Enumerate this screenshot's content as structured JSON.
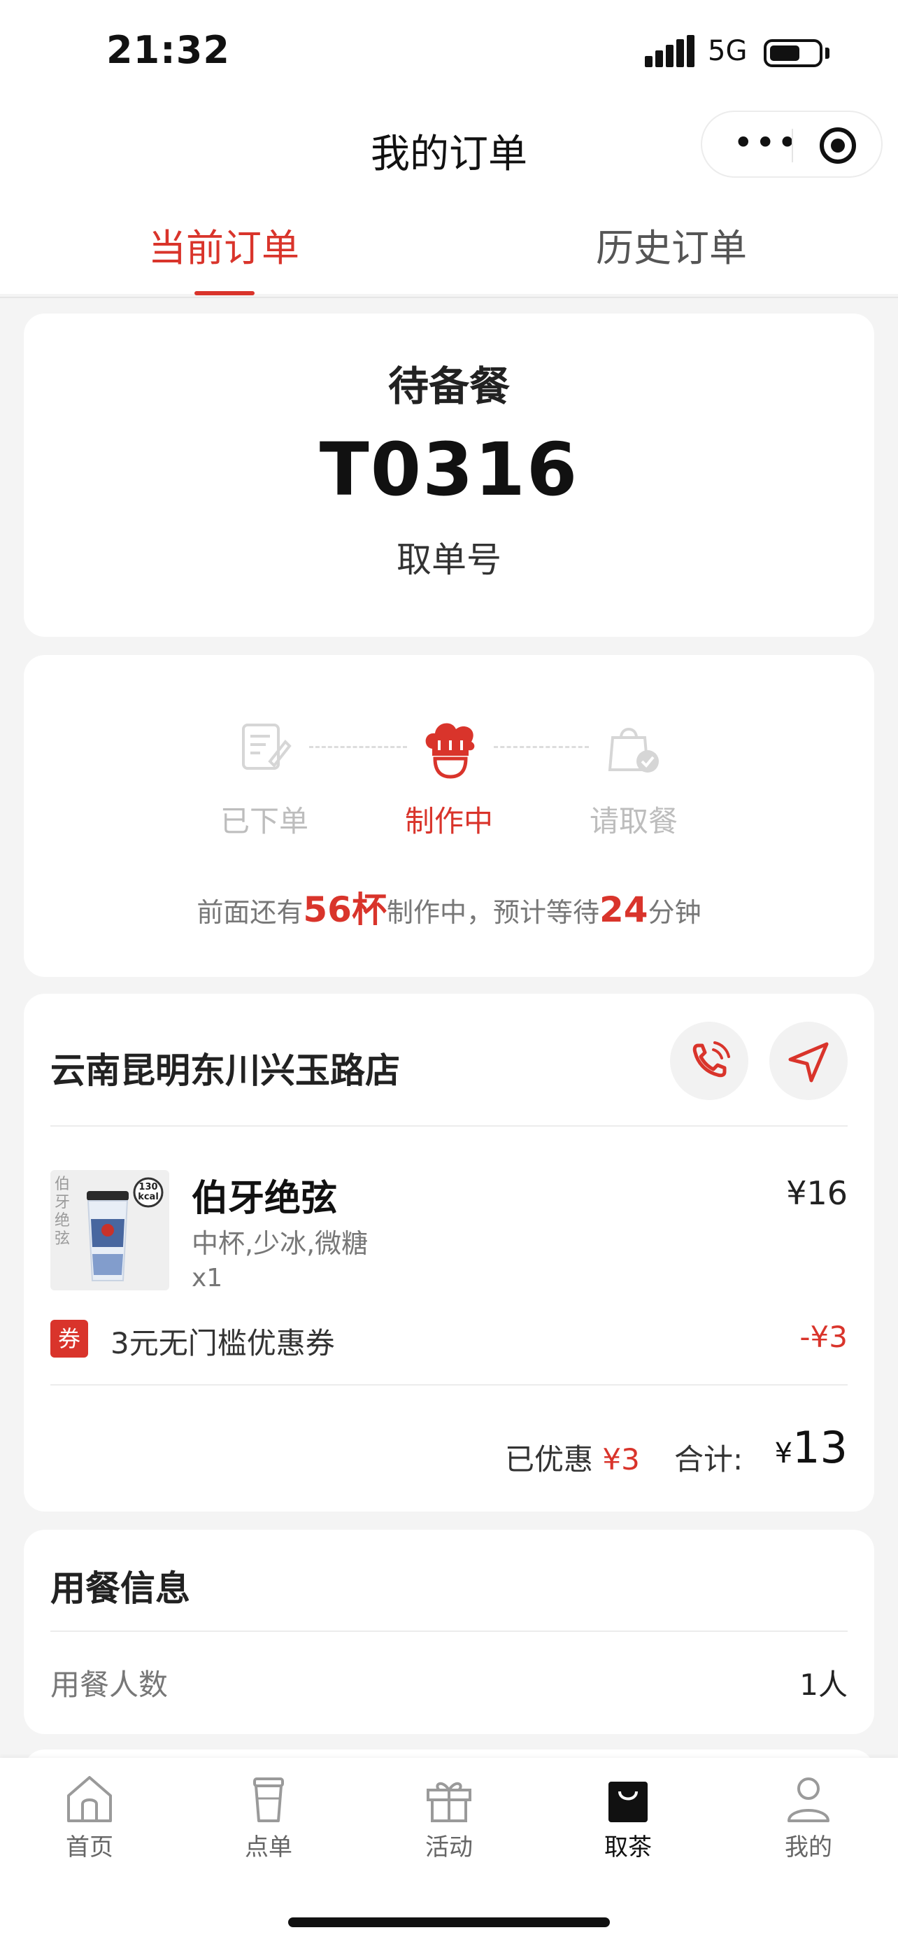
{
  "status_bar": {
    "time": "21:32",
    "network": "5G"
  },
  "header": {
    "title": "我的订单",
    "more_label": "•••"
  },
  "tabs": [
    {
      "label": "当前订单",
      "active": true
    },
    {
      "label": "历史订单",
      "active": false
    }
  ],
  "order": {
    "status": "待备餐",
    "pickup_number": "T0316",
    "pickup_label": "取单号"
  },
  "progress": {
    "steps": [
      {
        "label": "已下单",
        "state": "done"
      },
      {
        "label": "制作中",
        "state": "active"
      },
      {
        "label": "请取餐",
        "state": "pending"
      }
    ],
    "wait_prefix": "前面还有",
    "cups_ahead": "56杯",
    "wait_mid": "制作中，预计等待",
    "wait_minutes": "24",
    "wait_suffix": "分钟"
  },
  "store": {
    "name": "云南昆明东川兴玉路店",
    "product": {
      "name": "伯牙绝弦",
      "options": "中杯,少冰,微糖",
      "quantity": "x1",
      "price": "¥16",
      "thumb_text": "伯牙绝弦",
      "kcal": "130 kcal"
    },
    "coupon": {
      "badge": "券",
      "text": "3元无门槛优惠券",
      "amount": "-¥3"
    },
    "discount_label": "已优惠",
    "discount_amount": "¥3",
    "total_label": "合计:",
    "total_currency": "¥",
    "total_amount": "13"
  },
  "dining": {
    "title": "用餐信息",
    "diners_label": "用餐人数",
    "diners_value": "1人"
  },
  "nav": [
    {
      "label": "首页",
      "icon": "home-icon",
      "active": false
    },
    {
      "label": "点单",
      "icon": "cup-icon",
      "active": false
    },
    {
      "label": "活动",
      "icon": "gift-icon",
      "active": false
    },
    {
      "label": "取茶",
      "icon": "bag-icon",
      "active": true
    },
    {
      "label": "我的",
      "icon": "user-icon",
      "active": false
    }
  ],
  "colors": {
    "accent": "#d9342b",
    "muted": "#bdbdbd",
    "background": "#f4f4f4"
  }
}
